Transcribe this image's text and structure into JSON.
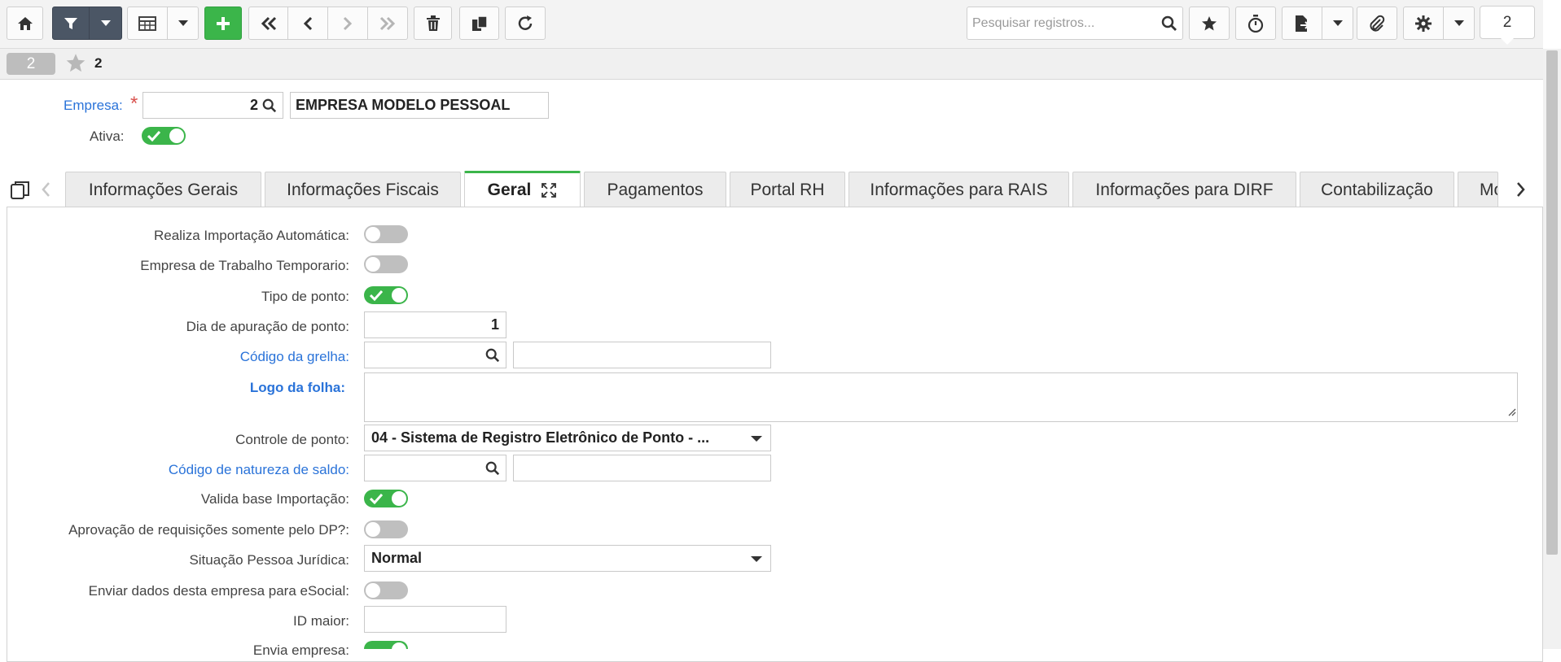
{
  "toolbar": {
    "search_placeholder": "Pesquisar registros...",
    "record_count": "2",
    "icons": [
      "home-icon",
      "filter-icon",
      "caret-down-icon",
      "table-icon",
      "plus-icon",
      "double-left-icon",
      "left-icon",
      "right-icon",
      "double-right-icon",
      "trash-icon",
      "copy-icon",
      "refresh-icon",
      "search-icon",
      "star-icon",
      "stopwatch-icon",
      "export-icon",
      "paperclip-icon",
      "gear-icon"
    ]
  },
  "breadcrumb": {
    "pill": "2",
    "favorite_count": "2"
  },
  "header": {
    "empresa_label": "Empresa:",
    "empresa_code": "2",
    "empresa_name": "EMPRESA MODELO PESSOAL",
    "ativa_label": "Ativa:",
    "ativa_on": true
  },
  "tabs": [
    {
      "label": "Informações Gerais",
      "active": false
    },
    {
      "label": "Informações Fiscais",
      "active": false
    },
    {
      "label": "Geral",
      "active": true
    },
    {
      "label": "Pagamentos",
      "active": false
    },
    {
      "label": "Portal RH",
      "active": false
    },
    {
      "label": "Informações para RAIS",
      "active": false
    },
    {
      "label": "Informações para DIRF",
      "active": false
    },
    {
      "label": "Contabilização",
      "active": false
    },
    {
      "label": "Mo",
      "active": false
    }
  ],
  "form": {
    "realiza_importacao": {
      "label": "Realiza Importação Automática:",
      "on": false
    },
    "empresa_temporario": {
      "label": "Empresa de Trabalho Temporario:",
      "on": false
    },
    "tipo_ponto": {
      "label": "Tipo de ponto:",
      "on": true
    },
    "dia_apuracao": {
      "label": "Dia de apuração de ponto:",
      "value": "1"
    },
    "codigo_grelha": {
      "label": "Código da grelha:",
      "code": "",
      "desc": ""
    },
    "logo_folha": {
      "label": "Logo da folha:"
    },
    "controle_ponto": {
      "label": "Controle de ponto:",
      "value": "04 - Sistema de Registro Eletrônico de Ponto - ..."
    },
    "codigo_natureza": {
      "label": "Código de natureza de saldo:",
      "code": "",
      "desc": ""
    },
    "valida_base": {
      "label": "Valida base Importação:",
      "on": true
    },
    "aprovacao_dp": {
      "label": "Aprovação de requisições somente pelo DP?:",
      "on": false
    },
    "situacao_pj": {
      "label": "Situação Pessoa Jurídica:",
      "value": "Normal"
    },
    "enviar_esocial": {
      "label": "Enviar dados desta empresa para eSocial:",
      "on": false
    },
    "id_maior": {
      "label": "ID maior:",
      "value": ""
    },
    "envia_empresa": {
      "label": "Envia empresa:",
      "on": true
    }
  },
  "colors": {
    "accent_green": "#3bb54a",
    "link_blue": "#2a73d9",
    "toolbar_dark": "#4b5665",
    "required_red": "#d9534f"
  }
}
